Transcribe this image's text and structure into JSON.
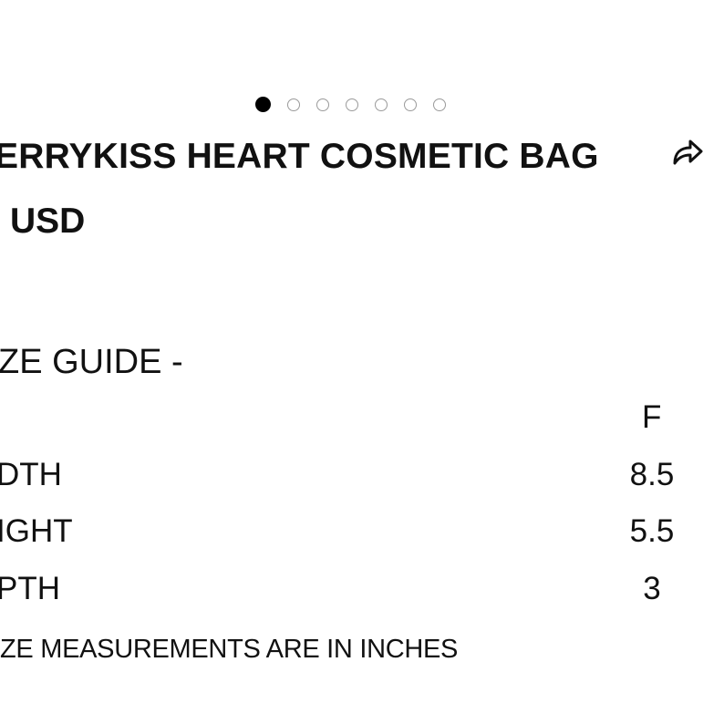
{
  "carousel": {
    "count": 7,
    "active_index": 0
  },
  "product": {
    "title": "ERRYKISS HEART COSMETIC BAG",
    "price": "USD"
  },
  "icons": {
    "share": "share-icon"
  },
  "size_guide": {
    "heading": "ZE GUIDE  -",
    "column_header": "F",
    "rows": [
      {
        "label": "DTH",
        "value": "8.5"
      },
      {
        "label": "IGHT",
        "value": "5.5"
      },
      {
        "label": "PTH",
        "value": "3"
      }
    ],
    "note": "ZE MEASUREMENTS ARE IN INCHES"
  }
}
